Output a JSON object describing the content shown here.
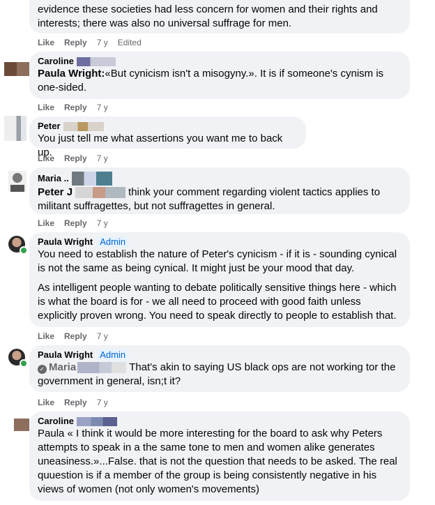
{
  "actions": {
    "like": "Like",
    "reply": "Reply",
    "time": "7 y",
    "edited": "Edited"
  },
  "comments": [
    {
      "text": "evidence these societies had less concern for women and their rights and interests; there was also no universal suffrage for men."
    },
    {
      "author": "Caroline",
      "mention": "Paula Wright:",
      "text": "«But cynicism isn't a misogyny.». It is if someone's cynism is one-sided."
    },
    {
      "author": "Peter",
      "text": "You just tell me what assertions you want me to back up."
    },
    {
      "author": "Maria ..",
      "mention": "Peter J",
      "text": "think your comment regarding violent tactics applies to militant suffragettes, but not suffragettes in general."
    },
    {
      "author": "Paula Wright",
      "badge": "Admin",
      "paragraphs": [
        "You need to establish the nature of Peter's cynicism - if it is - sounding cynical is not the same as being cynical. It might just be your mood that day.",
        "As intelligent people wanting to debate politically sensitive things here - which is what the board is for - we all need to proceed with good faith unless explicitly proven wrong. You need to speak directly to people to establish that."
      ]
    },
    {
      "author": "Paula Wright",
      "badge": "Admin",
      "mention": "Maria",
      "text": "That's akin to saying US black ops are not working tor the government in general, isn;t it?"
    },
    {
      "author": "Caroline",
      "text": "Paula « I think it would be more interesting for the board to ask why Peters attempts to speak in a the same tone to men and women alike generates uneasiness.»...False. that is not the question that needs to be asked. The real quuestion is if a member of the group is being consistently negative in his views of women (not only women's movements)"
    }
  ]
}
